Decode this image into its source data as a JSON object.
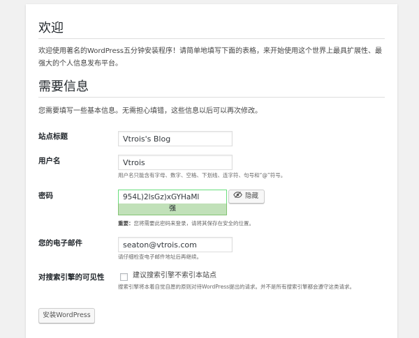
{
  "welcome": {
    "title": "欢迎",
    "text": "欢迎使用著名的WordPress五分钟安装程序！请简单地填写下面的表格，来开始使用这个世界上最具扩展性、最强大的个人信息发布平台。"
  },
  "info": {
    "title": "需要信息",
    "text": "您需要填写一些基本信息。无需担心填错，这些信息以后可以再次修改。"
  },
  "fields": {
    "site_title": {
      "label": "站点标题",
      "value": "Vtrois's Blog"
    },
    "username": {
      "label": "用户名",
      "value": "Vtrois",
      "desc": "用户名只能含有字母、数字、空格、下划线、连字符、句号和“@”符号。"
    },
    "password": {
      "label": "密码",
      "value": "954L)2lsGz)xGYHaMl",
      "strength": "强",
      "hide_label": "隐藏",
      "note_bold": "重要：",
      "note": "您将需要此密码来登录，请将其保存在安全的位置。"
    },
    "email": {
      "label": "您的电子邮件",
      "value": "seaton@vtrois.com",
      "desc": "请仔细检查电子邮件地址后再继续。"
    },
    "visibility": {
      "label": "对搜索引擎的可见性",
      "checkbox_label": "建议搜索引擎不索引本站点",
      "desc": "搜索引擎将本着自觉自愿的原则对待WordPress提出的请求。并不是所有搜索引擎都会遵守这类请求。"
    }
  },
  "install_button": "安装WordPress",
  "colors": {
    "strong_bg": "#c1e1b9",
    "strong_border": "#83c373"
  }
}
